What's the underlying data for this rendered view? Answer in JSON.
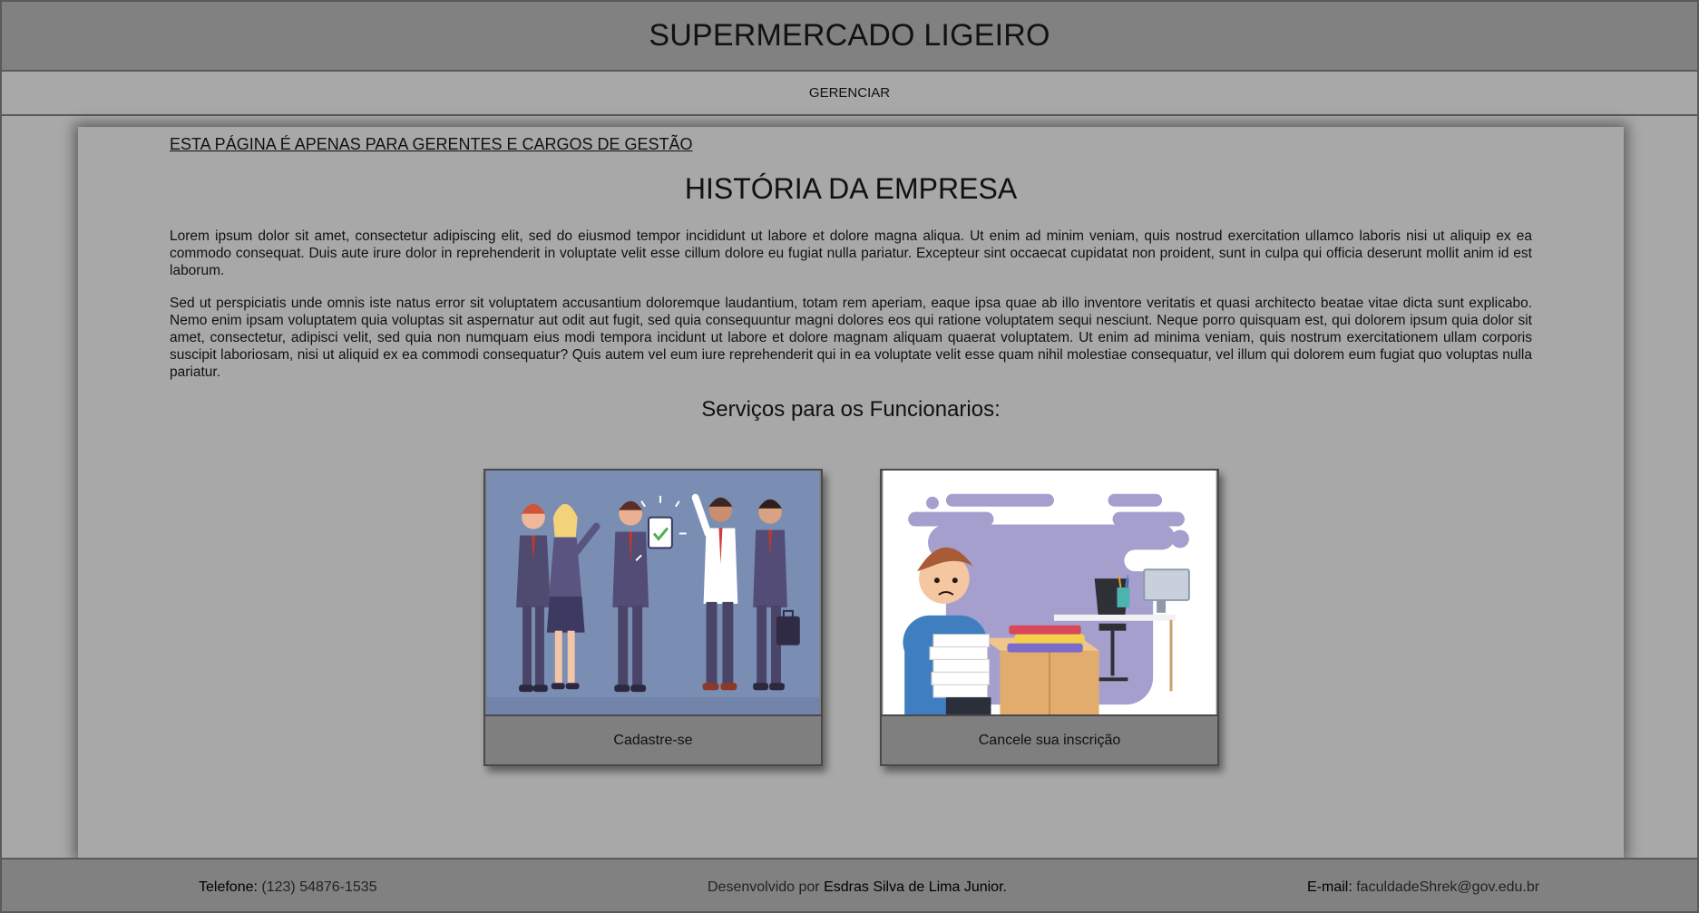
{
  "header": {
    "title": "SUPERMERCADO LIGEIRO"
  },
  "nav": {
    "items": [
      {
        "label": "GERENCIAR"
      }
    ]
  },
  "main": {
    "notice": "ESTA PÁGINA É APENAS PARA GERENTES E CARGOS DE GESTÃO",
    "title": "HISTÓRIA DA EMPRESA",
    "paragraphs": [
      "Lorem ipsum dolor sit amet, consectetur adipiscing elit, sed do eiusmod tempor incididunt ut labore et dolore magna aliqua. Ut enim ad minim veniam, quis nostrud exercitation ullamco laboris nisi ut aliquip ex ea commodo consequat. Duis aute irure dolor in reprehenderit in voluptate velit esse cillum dolore eu fugiat nulla pariatur. Excepteur sint occaecat cupidatat non proident, sunt in culpa qui officia deserunt mollit anim id est laborum.",
      "Sed ut perspiciatis unde omnis iste natus error sit voluptatem accusantium doloremque laudantium, totam rem aperiam, eaque ipsa quae ab illo inventore veritatis et quasi architecto beatae vitae dicta sunt explicabo. Nemo enim ipsam voluptatem quia voluptas sit aspernatur aut odit aut fugit, sed quia consequuntur magni dolores eos qui ratione voluptatem sequi nesciunt. Neque porro quisquam est, qui dolorem ipsum quia dolor sit amet, consectetur, adipisci velit, sed quia non numquam eius modi tempora incidunt ut labore et dolore magnam aliquam quaerat voluptatem. Ut enim ad minima veniam, quis nostrum exercitationem ullam corporis suscipit laboriosam, nisi ut aliquid ex ea commodi consequatur? Quis autem vel eum iure reprehenderit qui in ea voluptate velit esse quam nihil molestiae consequatur, vel illum qui dolorem eum fugiat quo voluptas nulla pariatur."
    ],
    "services_title": "Serviços para os Funcionarios:",
    "cards": [
      {
        "label": "Cadastre-se"
      },
      {
        "label": "Cancele sua inscrição"
      }
    ]
  },
  "footer": {
    "phone_label": "Telefone:",
    "phone_value": "(123) 54876-1535",
    "dev_prefix": "Desenvolvido por",
    "dev_name": "Esdras Silva de Lima Junior.",
    "email_label": "E-mail:",
    "email_value": "faculdadeShrek@gov.edu.br"
  },
  "colors": {
    "header_bg": "#818181",
    "page_bg": "#a8a8a8",
    "card1_bg": "#7a8db3",
    "card2_blob": "#a59fce"
  }
}
